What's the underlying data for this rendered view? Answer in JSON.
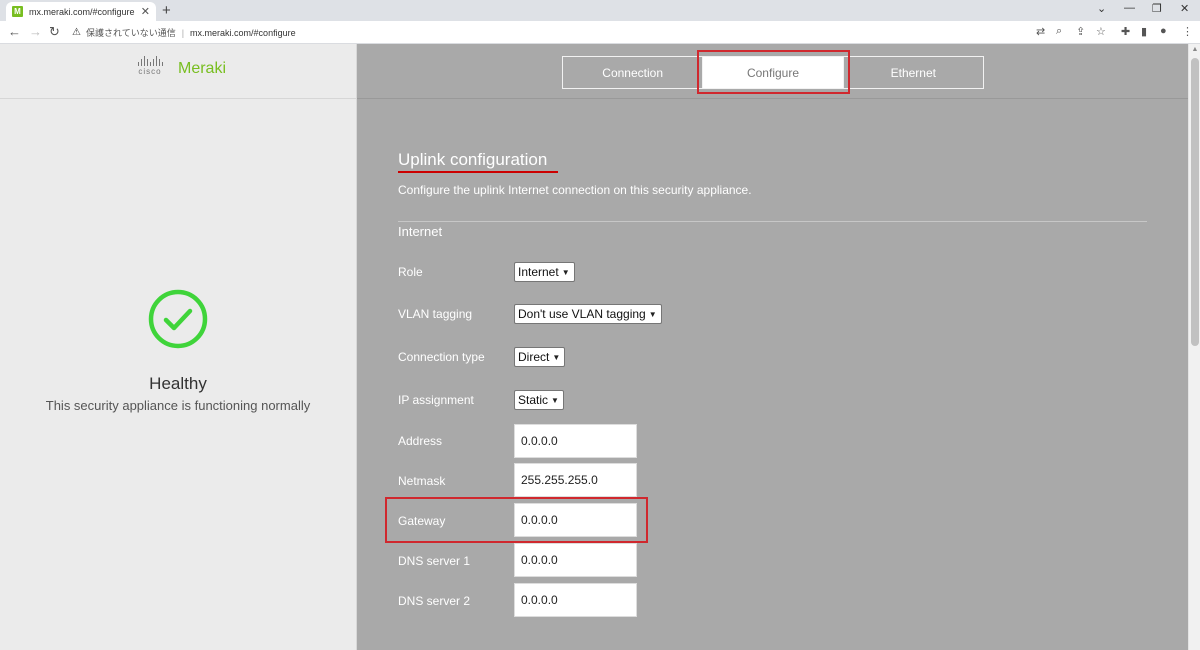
{
  "browser": {
    "tab_title": "mx.meraki.com/#configure",
    "favicon_letter": "M",
    "security_text": "保護されていない通信",
    "url": "mx.meraki.com/#configure"
  },
  "sidebar": {
    "cisco_word": "cisco",
    "brand": "Meraki",
    "status_title": "Healthy",
    "status_desc": "This security appliance is functioning normally"
  },
  "tabs": [
    {
      "label": "Connection",
      "active": false
    },
    {
      "label": "Configure",
      "active": true
    },
    {
      "label": "Ethernet",
      "active": false
    }
  ],
  "main": {
    "title": "Uplink configuration",
    "description": "Configure the uplink Internet connection on this security appliance.",
    "subsection": "Internet",
    "role_label": "Role",
    "role_value": "Internet",
    "vlan_label": "VLAN tagging",
    "vlan_value": "Don't use VLAN tagging",
    "conntype_label": "Connection type",
    "conntype_value": "Direct",
    "ipassign_label": "IP assignment",
    "ipassign_value": "Static",
    "address_label": "Address",
    "address_value": "0.0.0.0",
    "netmask_label": "Netmask",
    "netmask_value": "255.255.255.0",
    "gateway_label": "Gateway",
    "gateway_value": "0.0.0.0",
    "dns1_label": "DNS server 1",
    "dns1_value": "0.0.0.0",
    "dns2_label": "DNS server 2",
    "dns2_value": "0.0.0.0"
  },
  "colors": {
    "brand_green": "#78be20",
    "health_green": "#3fd43a",
    "highlight_red": "#d0282e",
    "panel_gray": "#a9a9a9"
  }
}
